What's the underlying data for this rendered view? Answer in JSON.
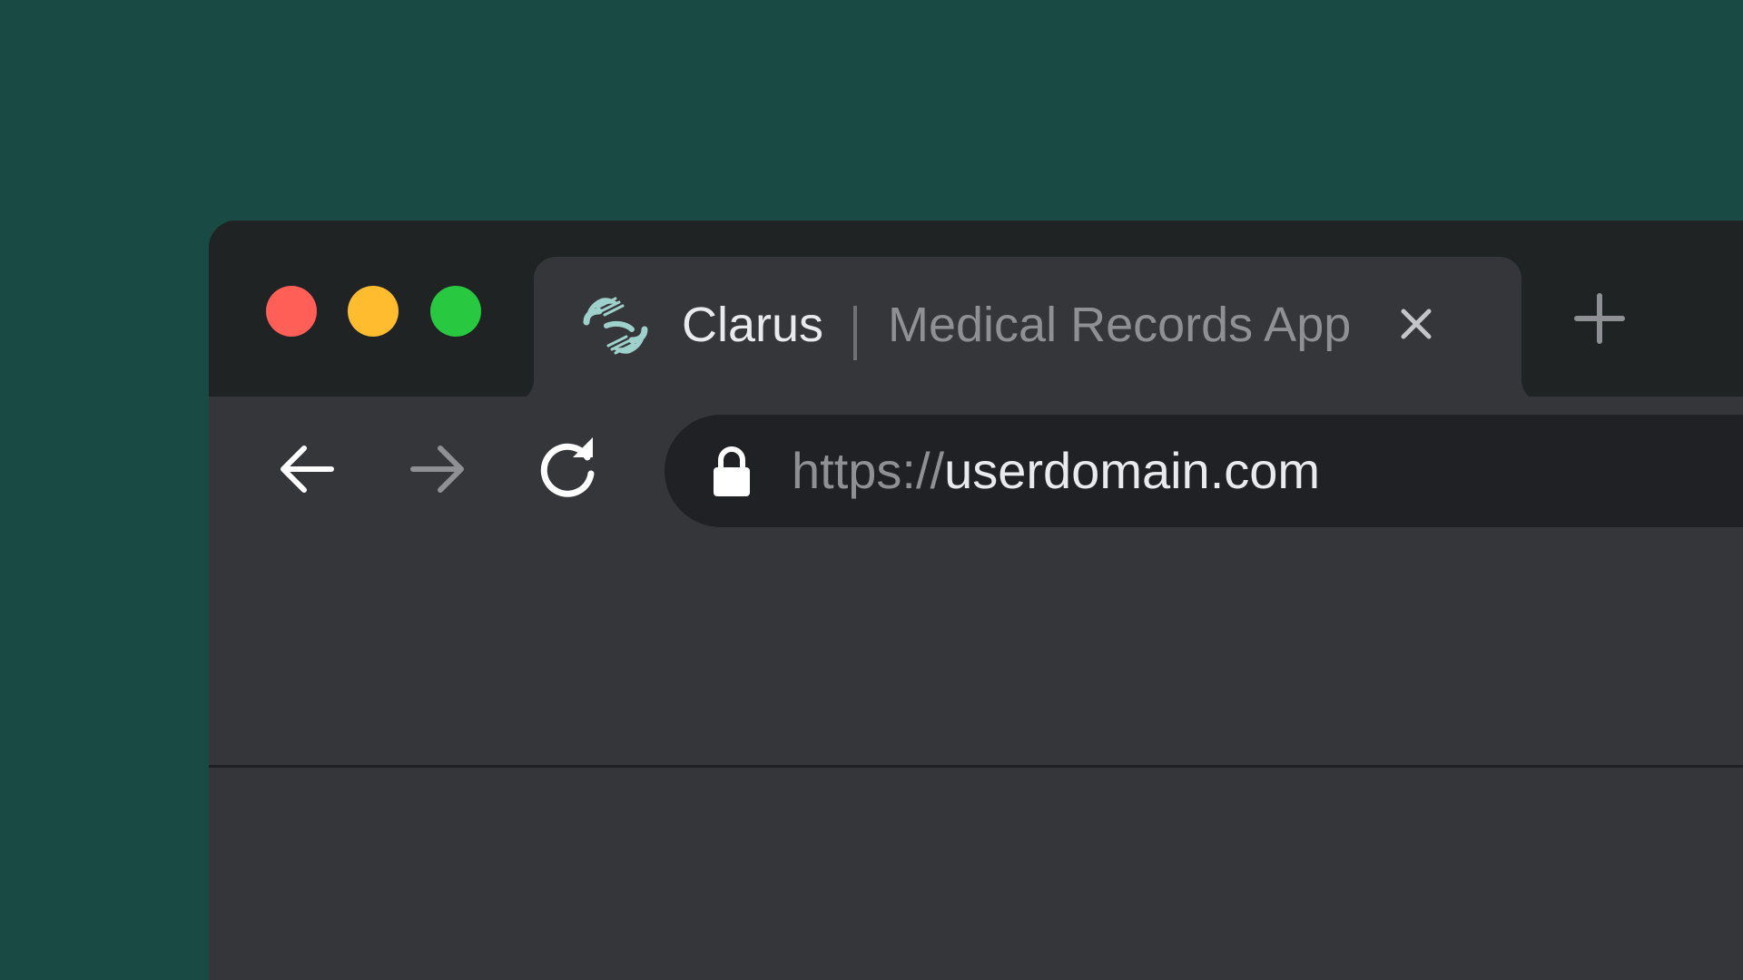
{
  "window": {
    "traffic_lights": [
      "close",
      "minimize",
      "maximize"
    ],
    "colors": {
      "background": "#1a4a44",
      "frame": "#202324",
      "tab": "#35363a",
      "close": "#ff5f57",
      "minimize": "#febc2e",
      "maximize": "#28c840",
      "favicon": "#9fd1cc"
    }
  },
  "tab": {
    "favicon_icon": "clarus-logo-icon",
    "title_brand": "Clarus",
    "title_separator": "|",
    "title_sub": "Medical Records App",
    "close_icon": "close-icon"
  },
  "new_tab_icon": "plus-icon",
  "toolbar": {
    "back_icon": "arrow-left-icon",
    "forward_icon": "arrow-right-icon",
    "reload_icon": "reload-icon",
    "lock_icon": "lock-icon",
    "url_scheme": "https://",
    "url_host": "userdomain.com"
  }
}
